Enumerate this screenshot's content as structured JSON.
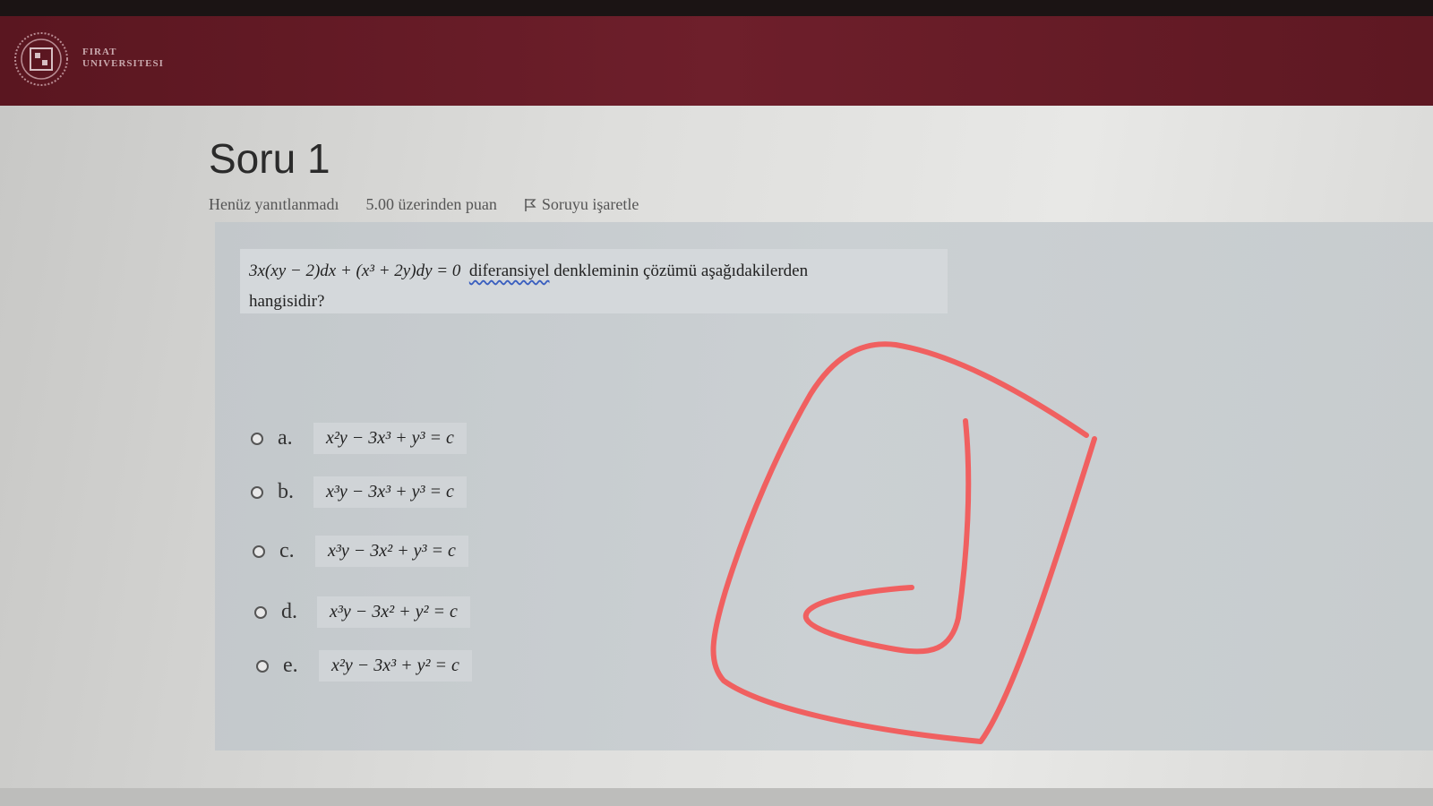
{
  "header": {
    "university_line1": "FIRAT",
    "university_line2": "UNIVERSITESI",
    "brand_color": "#6e1f2b"
  },
  "question": {
    "title": "Soru 1",
    "status": "Henüz yanıtlanmadı",
    "points": "5.00 üzerinden puan",
    "flag_label": "Soruyu işaretle",
    "equation": "3x(xy − 2)dx + (x³ + 2y)dy = 0",
    "text_underlined": "diferansiyel",
    "text_rest": " denkleminin çözümü aşağıdakilerden",
    "text_line2": "hangisidir?"
  },
  "options": [
    {
      "letter": "a.",
      "formula": "x²y − 3x³ + y³ = c"
    },
    {
      "letter": "b.",
      "formula": "x³y − 3x³ + y³ = c"
    },
    {
      "letter": "c.",
      "formula": "x³y − 3x² + y³ = c"
    },
    {
      "letter": "d.",
      "formula": "x³y − 3x² + y² = c"
    },
    {
      "letter": "e.",
      "formula": "x²y − 3x³ + y² = c"
    }
  ],
  "annotation": {
    "icon": "hand-drawn-check-icon",
    "color": "#f06060"
  }
}
